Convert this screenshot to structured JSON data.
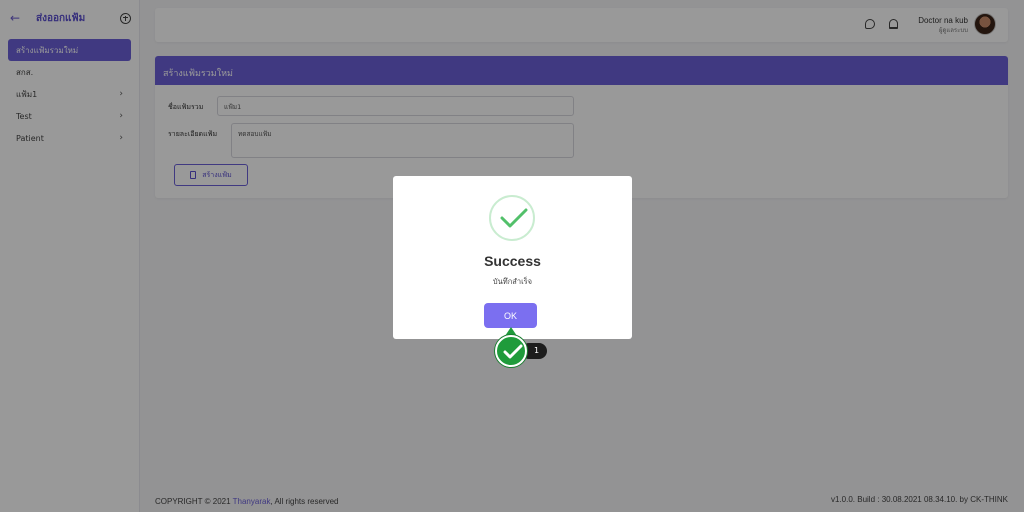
{
  "sidebar": {
    "back_icon": "arrow-left-icon",
    "title": "ส่งออกแฟ้ม",
    "add_icon": "plus-circle-icon",
    "items": [
      {
        "label": "สร้างแฟ้มรวมใหม่",
        "active": true
      },
      {
        "label": "สกส.",
        "active": false
      },
      {
        "label": "แฟ้ม1",
        "active": false,
        "has_children": true
      },
      {
        "label": "Test",
        "active": false,
        "has_children": true
      },
      {
        "label": "Patient",
        "active": false,
        "has_children": true
      }
    ],
    "chevron": "›"
  },
  "topbar": {
    "chat_icon": "chat-icon",
    "bell_icon": "bell-icon",
    "username": "Doctor na kub",
    "role": "ผู้ดูแลระบบ"
  },
  "form": {
    "header": "สร้างแฟ้มรวมใหม่",
    "name_label": "ชื่อแฟ้มรวม",
    "name_value": "แฟ้ม1",
    "desc_label": "รายละเอียดแฟ้ม",
    "desc_value": "ทดสอบแฟ้ม",
    "create_button": "สร้างแฟ้ม"
  },
  "footer": {
    "copyright_prefix": "COPYRIGHT © 2021 ",
    "copyright_link": "Thanyarak",
    "copyright_suffix": ", All rights reserved",
    "version": "v1.0.0. Build : 30.08.2021 08.34.10. by CK-THINK"
  },
  "modal": {
    "title": "Success",
    "message": "บันทึกสำเร็จ",
    "ok_label": "OK",
    "icon": "success-check-icon"
  },
  "click_marker": {
    "step": "1"
  },
  "colors": {
    "accent": "#6b5fd8",
    "success": "#1f9b3b"
  }
}
